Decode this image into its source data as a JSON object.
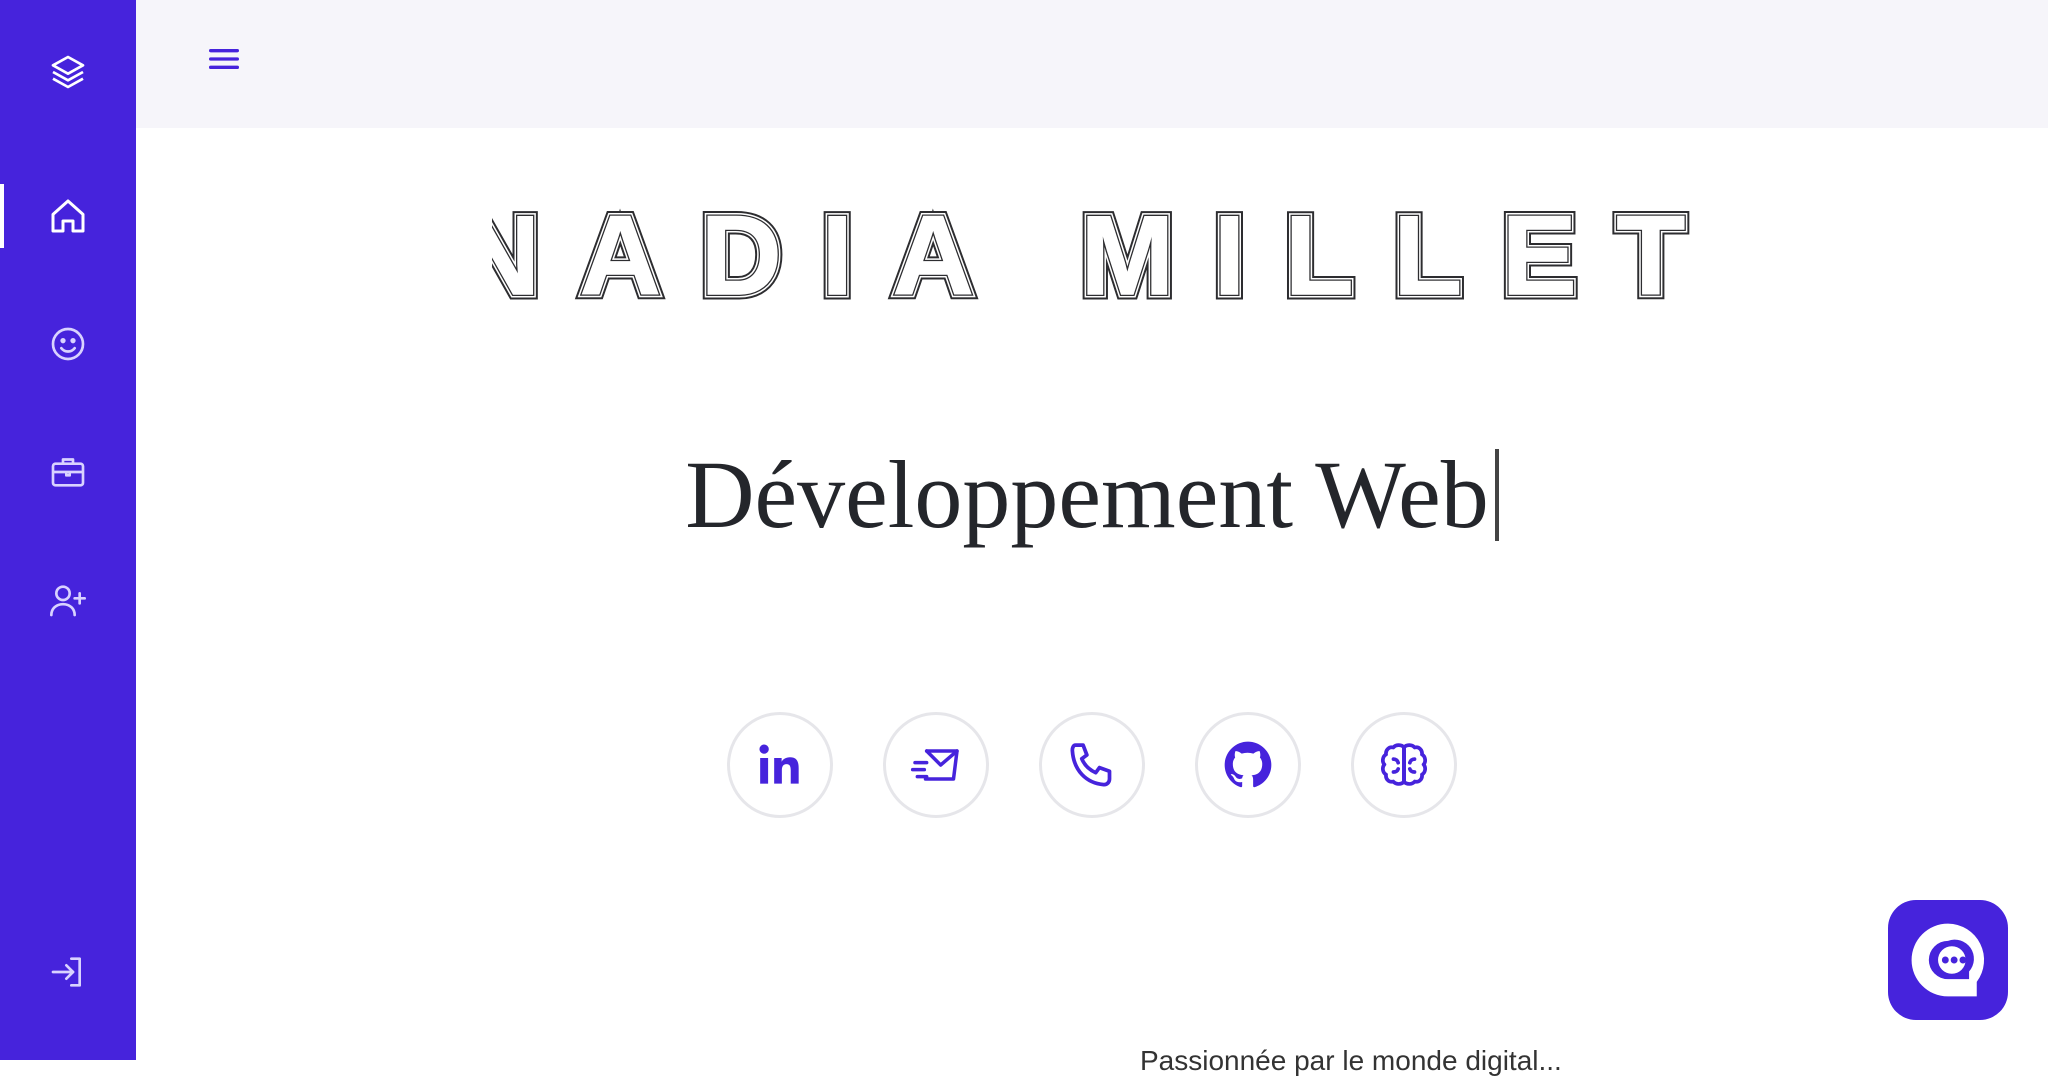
{
  "sidebar": {
    "icons": [
      "layers-icon",
      "home-icon",
      "smile-icon",
      "briefcase-icon",
      "user-plus-icon",
      "sign-in-icon"
    ],
    "active": "home-icon",
    "bg_color": "#4623dc"
  },
  "topbar": {
    "menu_icon": "hamburger-icon",
    "bg_color": "#f6f5fa"
  },
  "hero": {
    "name": "NADIA MILLET",
    "subtitle": "Développement Web"
  },
  "socials": [
    "linkedin-icon",
    "mail-icon",
    "phone-icon",
    "github-icon",
    "brain-icon"
  ],
  "chat": {
    "icon": "chat-icon"
  },
  "footer": {
    "text": "Passionnée par le monde digital..."
  },
  "colors": {
    "accent": "#4623dc",
    "text": "#24262b"
  }
}
